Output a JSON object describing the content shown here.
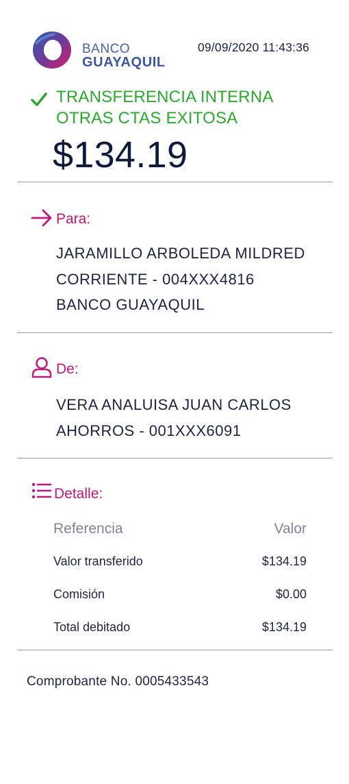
{
  "header": {
    "brand_line1": "BANCO",
    "brand_line2": "GUAYAQUIL",
    "timestamp": "09/09/2020 11:43:36",
    "status_line1": "TRANSFERENCIA INTERNA",
    "status_line2": "OTRAS CTAS EXITOSA",
    "amount": "$134.19"
  },
  "para": {
    "title": "Para:",
    "icon": "arrow-right-icon",
    "lines": [
      "JARAMILLO ARBOLEDA MILDRED",
      "CORRIENTE - 004XXX4816",
      "BANCO GUAYAQUIL"
    ]
  },
  "de": {
    "title": "De:",
    "icon": "user-icon",
    "lines": [
      "VERA ANALUISA JUAN CARLOS",
      "AHORROS - 001XXX6091"
    ]
  },
  "detalle": {
    "title": "Detalle:",
    "icon": "list-icon",
    "headers": [
      "Referencia",
      "Valor"
    ],
    "rows": [
      {
        "label": "Valor transferido",
        "value": "$134.19"
      },
      {
        "label": "Comisión",
        "value": "$0.00"
      },
      {
        "label": "Total debitado",
        "value": "$134.19"
      }
    ]
  },
  "footer": {
    "voucher": "Comprobante No. 0005433543"
  },
  "colors": {
    "success": "#2ca82f",
    "accent": "#c1167b",
    "brand": "#3d56a0",
    "text": "#1b2440",
    "muted": "#7d8596"
  }
}
